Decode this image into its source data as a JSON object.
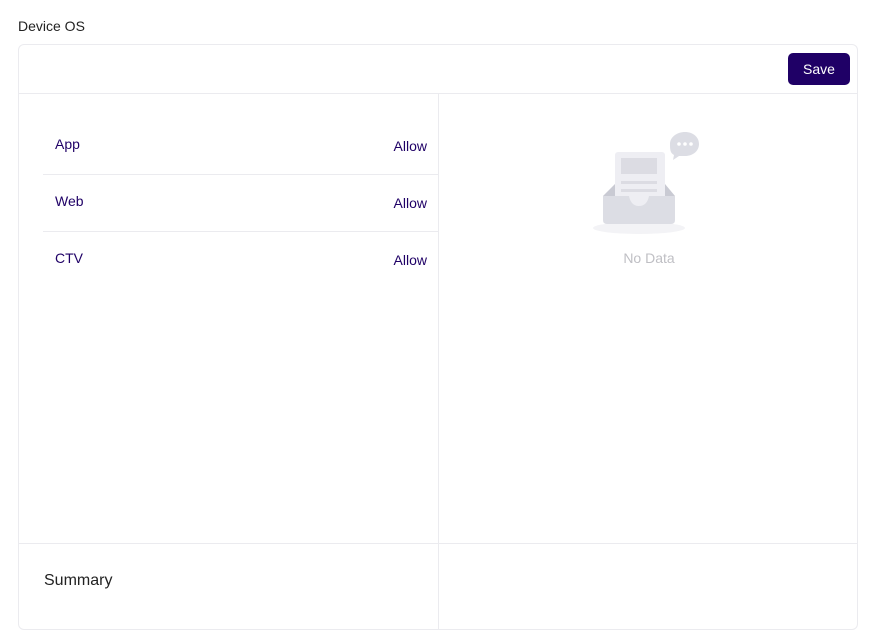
{
  "section": {
    "title": "Device OS"
  },
  "toolbar": {
    "save_label": "Save"
  },
  "os_list": {
    "items": [
      {
        "name": "App",
        "action": "Allow"
      },
      {
        "name": "Web",
        "action": "Allow"
      },
      {
        "name": "CTV",
        "action": "Allow"
      }
    ]
  },
  "selected": {
    "empty_text": "No Data",
    "empty_icon": "inbox-empty-icon"
  },
  "summary": {
    "label": "Summary"
  },
  "colors": {
    "accent": "#1f0066",
    "border": "#ebebef",
    "muted_text": "#bfbfc4"
  }
}
